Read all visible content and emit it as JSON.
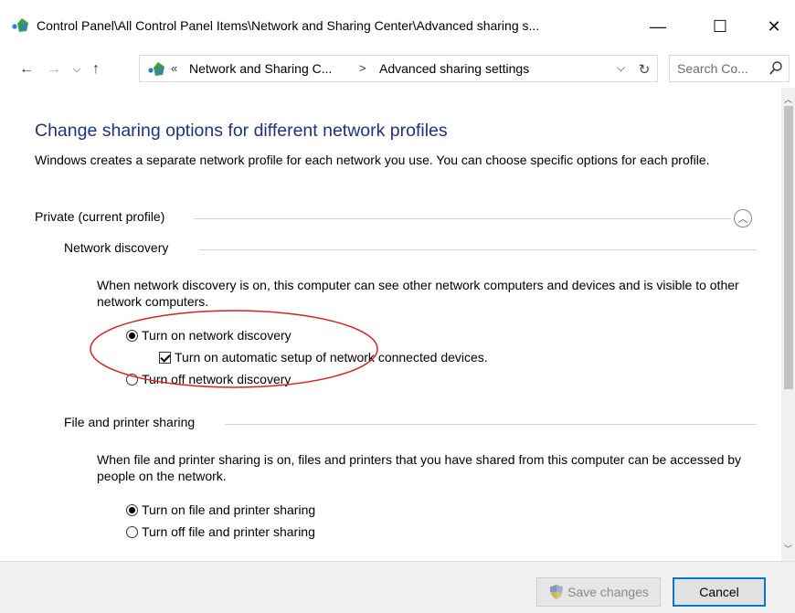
{
  "window": {
    "title": "Control Panel\\All Control Panel Items\\Network and Sharing Center\\Advanced sharing s...",
    "icon": "network-globe-icon",
    "controls": {
      "minimize": "—",
      "maximize": "☐",
      "close": "✕"
    }
  },
  "address_bar": {
    "chevrons": "«",
    "breadcrumbs": [
      "Network and Sharing C...",
      "Advanced sharing settings"
    ],
    "separator": ">",
    "dropdown": "⌵",
    "refresh": "↻",
    "search_placeholder": "Search Co..."
  },
  "nav": {
    "back": "←",
    "forward": "→",
    "recent": "⌵",
    "up": "↑"
  },
  "content": {
    "title": "Change sharing options for different network profiles",
    "intro": "Windows creates a separate network profile for each network you use. You can choose specific options for each profile.",
    "profile": {
      "label": "Private (current profile)",
      "collapse_icon": "︿",
      "sections": [
        {
          "heading": "Network discovery",
          "description": "When network discovery is on, this computer can see other network computers and devices and is visible to other network computers.",
          "options": [
            {
              "label": "Turn on network discovery",
              "type": "radio",
              "checked": true
            },
            {
              "label": "Turn on automatic setup of network connected devices.",
              "type": "checkbox",
              "checked": true
            },
            {
              "label": "Turn off network discovery",
              "type": "radio",
              "checked": false
            }
          ]
        },
        {
          "heading": "File and printer sharing",
          "description": "When file and printer sharing is on, files and printers that you have shared from this computer can be accessed by people on the network.",
          "options": [
            {
              "label": "Turn on file and printer sharing",
              "type": "radio",
              "checked": true
            },
            {
              "label": "Turn off file and printer sharing",
              "type": "radio",
              "checked": false
            }
          ]
        }
      ]
    }
  },
  "scrollbar": {
    "up": "︿",
    "down": "﹀"
  },
  "footer": {
    "save_label": "Save changes",
    "cancel_label": "Cancel",
    "save_icon": "uac-shield-icon"
  },
  "colors": {
    "title_blue": "#1e3287",
    "annotation_red": "#e02020",
    "accent": "#0078d7"
  }
}
